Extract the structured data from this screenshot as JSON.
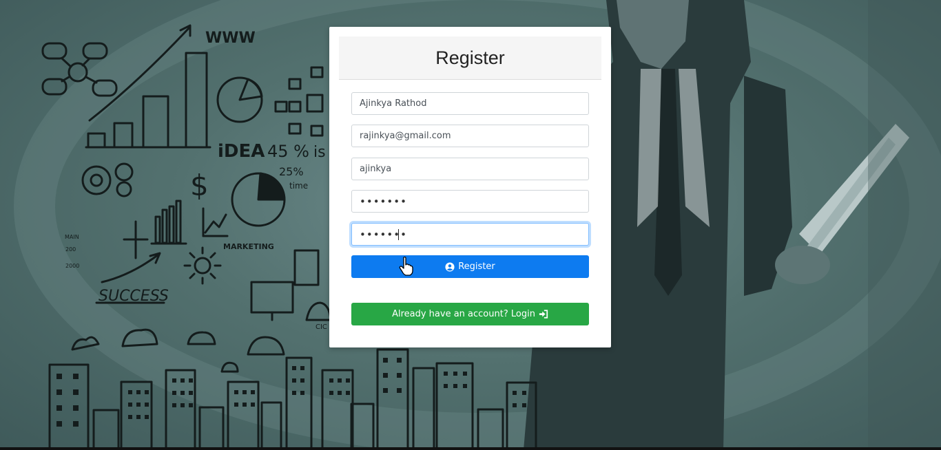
{
  "background": {
    "illustration_texts": {
      "www": "WWW",
      "idea": "iDEA",
      "percent_45": "45 %",
      "is": "is",
      "percent_25": "25%",
      "time": "time",
      "marketing": "MARKETING",
      "success": "SUCCESS",
      "main": "MAIN",
      "n200": "200",
      "n2000": "2000",
      "dollar": "$",
      "cic": "CIC"
    }
  },
  "register_form": {
    "title": "Register",
    "fields": {
      "full_name": "Ajinkya Rathod",
      "email": "rajinkya@gmail.com",
      "username": "ajinkya",
      "password": "•••••••",
      "confirm_password": "•••••••"
    },
    "register_button": {
      "label": "Register",
      "icon": "user-circle-icon",
      "color": "#0d7bf0"
    },
    "login_button": {
      "label": "Already have an account? Login",
      "icon": "sign-in-icon",
      "color": "#28a745"
    }
  }
}
